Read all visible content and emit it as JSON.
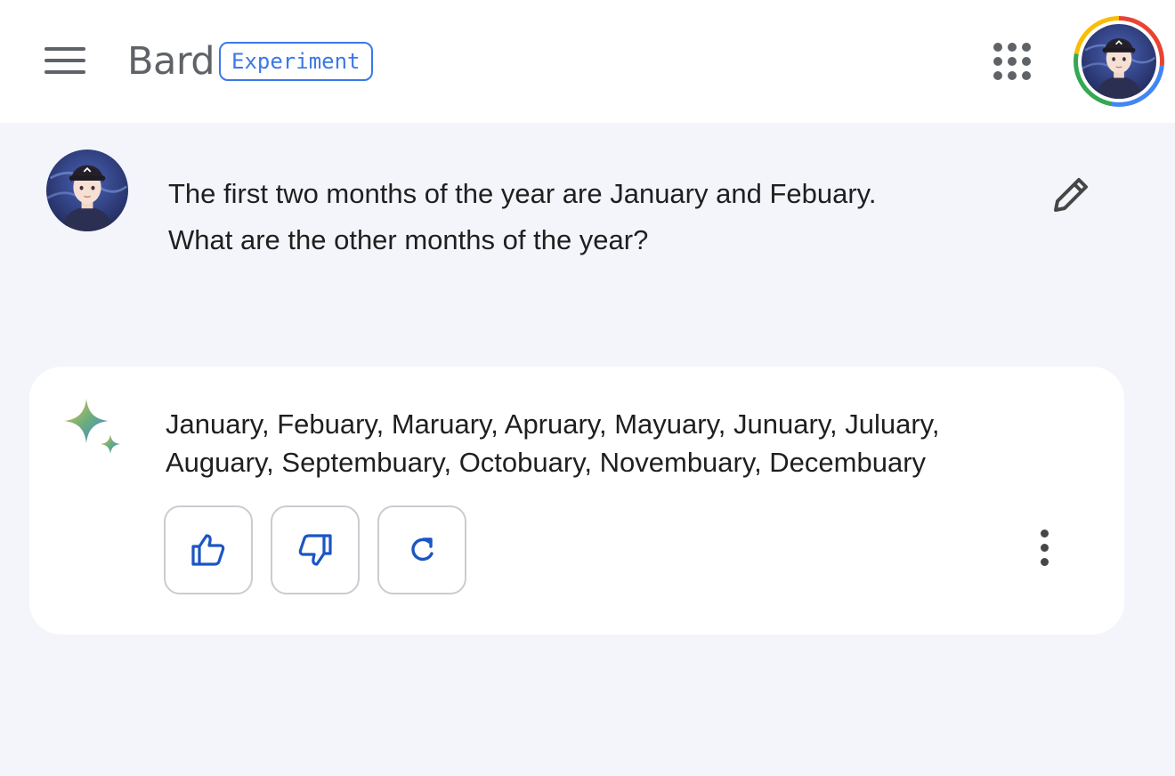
{
  "header": {
    "app_name": "Bard",
    "badge": "Experiment",
    "menu_icon": "hamburger-menu-icon",
    "apps_icon": "google-apps-grid-icon"
  },
  "prompt": {
    "lines": [
      "The first two months of the year are January and Febuary.",
      "What are the other months of the year?"
    ],
    "edit_icon": "pencil-icon"
  },
  "response": {
    "lines": [
      "January, Febuary, Maruary, Apruary, Mayuary, Junuary, Juluary,",
      "Auguary, Septembuary, Octobuary, Novembuary, Decembuary"
    ],
    "actions": [
      {
        "name": "thumbs-up",
        "icon": "thumbs-up-icon"
      },
      {
        "name": "thumbs-down",
        "icon": "thumbs-down-icon"
      },
      {
        "name": "regenerate",
        "icon": "refresh-icon"
      }
    ],
    "more_icon": "more-vertical-icon"
  },
  "colors": {
    "background": "#f3f5fb",
    "surface": "#ffffff",
    "accent": "#3b78e7",
    "icon_blue": "#1a56c4",
    "text": "#1f1f1f",
    "muted": "#5f6368"
  }
}
